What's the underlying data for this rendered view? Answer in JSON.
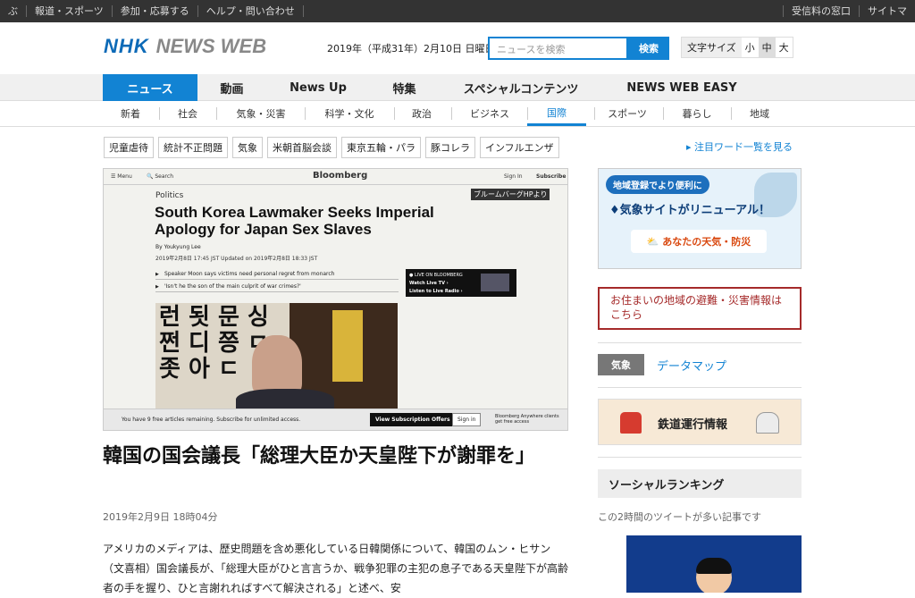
{
  "topbar": {
    "left": [
      "ぶ",
      "報道・スポーツ",
      "参加・応募する",
      "ヘルプ・問い合わせ"
    ],
    "right": [
      "受信料の窓口",
      "サイトマ"
    ]
  },
  "header": {
    "logo_nhk": "NHK",
    "logo_newsweb": "NEWS WEB",
    "date": "2019年（平成31年）2月10日 日曜日",
    "search_placeholder": "ニュースを検索",
    "search_button": "検索",
    "fontsize_label": "文字サイズ",
    "fontsize_options": [
      "小",
      "中",
      "大"
    ],
    "fontsize_selected": "中"
  },
  "mainnav": [
    "ニュース",
    "動画",
    "News Up",
    "特集",
    "スペシャルコンテンツ",
    "NEWS WEB EASY"
  ],
  "subnav": [
    "新着",
    "社会",
    "気象・災害",
    "科学・文化",
    "政治",
    "ビジネス",
    "国際",
    "スポーツ",
    "暮らし",
    "地域"
  ],
  "subnav_active": "国際",
  "tags": [
    "児童虐待",
    "統計不正問題",
    "気象",
    "米朝首脳会談",
    "東京五輪・パラ",
    "豚コレラ",
    "インフルエンザ"
  ],
  "tags_link": "▸ 注目ワード一覧を見る",
  "hero": {
    "menu": "☰ Menu",
    "search": "🔍 Search",
    "brand": "Bloomberg",
    "signin": "Sign In",
    "subscribe": "Subscribe",
    "credit": "ブルームバーグHPより",
    "category": "Politics",
    "headline": "South Korea Lawmaker Seeks Imperial Apology for Japan Sex Slaves",
    "byline": "By Youkyung Lee",
    "dateline": "2019年2月8日 17:45 JST   Updated on 2019年2月8日 18:33 JST",
    "bullets": [
      "Speaker Moon says victims need personal regret from monarch",
      "'Isn't he the son of the main culprit of war crimes?'"
    ],
    "live_label": "● LIVE ON BLOOMBERG",
    "live_tv": "Watch Live TV ›",
    "live_radio": "Listen to Live Radio ›",
    "calligraphy": "런 됫 문 싱\n쩐 디 쯩 ㅁ\n좃 아 ㄷ",
    "paywall_msg": "You have 9 free articles remaining. Subscribe for unlimited access.",
    "paywall_offer": "View Subscription Offers",
    "paywall_signin": "Sign in",
    "paywall_anywhere": "Bloomberg Anywhere clients get free access"
  },
  "article": {
    "title": "韓国の国会議長「総理大臣か天皇陛下が謝罪を」",
    "date": "2019年2月9日 18時04分",
    "body": "アメリカのメディアは、歴史問題を含め悪化している日韓関係について、韓国のムン・ヒサン（文喜相）国会議長が、「総理大臣がひと言言うか、戦争犯罪の主犯の息子である天皇陛下が高齢者の手を握り、ひと言謝れればすべて解決される」と述べ、安"
  },
  "sidebar": {
    "ad1_pill": "地域登録でより便利に",
    "ad1_head": "♦気象サイトがリニューアル！",
    "ad1_btn": "⛅ あなたの天気・防災",
    "ad2_text": "お住まいの地域の避難・災害情報はこちら",
    "weather_badge": "気象",
    "weather_link": "データマップ",
    "rail_label": "鉄道運行情報",
    "social_title": "ソーシャルランキング",
    "social_sub": "この2時間のツイートが多い記事です"
  }
}
